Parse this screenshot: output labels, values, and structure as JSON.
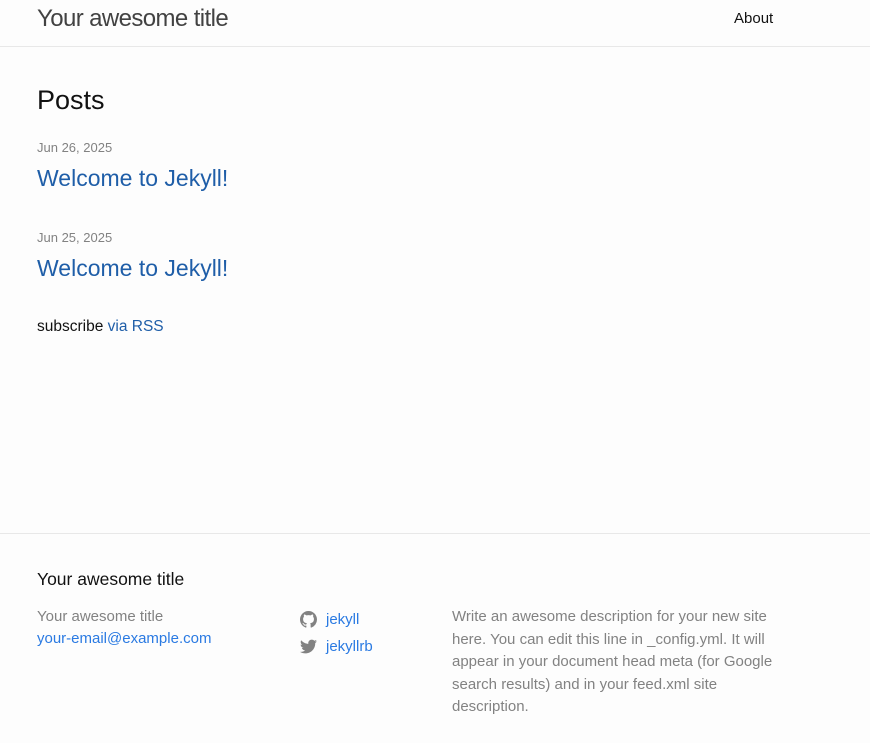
{
  "header": {
    "site_title": "Your awesome title",
    "nav": [
      {
        "label": "About"
      }
    ]
  },
  "main": {
    "heading": "Posts",
    "posts": [
      {
        "date": "Jun 26, 2025",
        "title": "Welcome to Jekyll!"
      },
      {
        "date": "Jun 25, 2025",
        "title": "Welcome to Jekyll!"
      }
    ],
    "subscribe_text": "subscribe",
    "subscribe_link": "via RSS"
  },
  "footer": {
    "heading": "Your awesome title",
    "name": "Your awesome title",
    "email": "your-email@example.com",
    "social": [
      {
        "icon": "github-icon",
        "label": "jekyll"
      },
      {
        "icon": "twitter-icon",
        "label": "jekyllrb"
      }
    ],
    "description": "Write an awesome description for your new site here. You can edit this line in _config.yml. It will appear in your document head meta (for Google search results) and in your feed.xml site description."
  },
  "colors": {
    "link": "#2a7ae2",
    "text": "#111111",
    "muted": "#828282",
    "background": "#fdfdfd",
    "border": "#e8e8e8"
  }
}
